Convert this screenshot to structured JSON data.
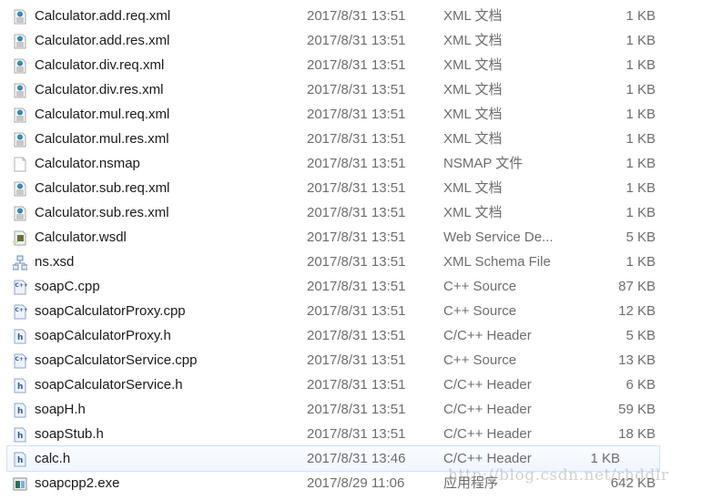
{
  "files": [
    {
      "name": "Calculator.add.req.xml",
      "date": "2017/8/31 13:51",
      "type": "XML 文档",
      "size": "1 KB",
      "icon": "xml-document-icon"
    },
    {
      "name": "Calculator.add.res.xml",
      "date": "2017/8/31 13:51",
      "type": "XML 文档",
      "size": "1 KB",
      "icon": "xml-document-icon"
    },
    {
      "name": "Calculator.div.req.xml",
      "date": "2017/8/31 13:51",
      "type": "XML 文档",
      "size": "1 KB",
      "icon": "xml-document-icon"
    },
    {
      "name": "Calculator.div.res.xml",
      "date": "2017/8/31 13:51",
      "type": "XML 文档",
      "size": "1 KB",
      "icon": "xml-document-icon"
    },
    {
      "name": "Calculator.mul.req.xml",
      "date": "2017/8/31 13:51",
      "type": "XML 文档",
      "size": "1 KB",
      "icon": "xml-document-icon"
    },
    {
      "name": "Calculator.mul.res.xml",
      "date": "2017/8/31 13:51",
      "type": "XML 文档",
      "size": "1 KB",
      "icon": "xml-document-icon"
    },
    {
      "name": "Calculator.nsmap",
      "date": "2017/8/31 13:51",
      "type": "NSMAP 文件",
      "size": "1 KB",
      "icon": "blank-file-icon"
    },
    {
      "name": "Calculator.sub.req.xml",
      "date": "2017/8/31 13:51",
      "type": "XML 文档",
      "size": "1 KB",
      "icon": "xml-document-icon"
    },
    {
      "name": "Calculator.sub.res.xml",
      "date": "2017/8/31 13:51",
      "type": "XML 文档",
      "size": "1 KB",
      "icon": "xml-document-icon"
    },
    {
      "name": "Calculator.wsdl",
      "date": "2017/8/31 13:51",
      "type": "Web Service De...",
      "size": "5 KB",
      "icon": "wsdl-file-icon"
    },
    {
      "name": "ns.xsd",
      "date": "2017/8/31 13:51",
      "type": "XML Schema File",
      "size": "1 KB",
      "icon": "xsd-schema-icon"
    },
    {
      "name": "soapC.cpp",
      "date": "2017/8/31 13:51",
      "type": "C++ Source",
      "size": "87 KB",
      "icon": "cpp-source-icon"
    },
    {
      "name": "soapCalculatorProxy.cpp",
      "date": "2017/8/31 13:51",
      "type": "C++ Source",
      "size": "12 KB",
      "icon": "cpp-source-icon"
    },
    {
      "name": "soapCalculatorProxy.h",
      "date": "2017/8/31 13:51",
      "type": "C/C++ Header",
      "size": "5 KB",
      "icon": "header-file-icon"
    },
    {
      "name": "soapCalculatorService.cpp",
      "date": "2017/8/31 13:51",
      "type": "C++ Source",
      "size": "13 KB",
      "icon": "cpp-source-icon"
    },
    {
      "name": "soapCalculatorService.h",
      "date": "2017/8/31 13:51",
      "type": "C/C++ Header",
      "size": "6 KB",
      "icon": "header-file-icon"
    },
    {
      "name": "soapH.h",
      "date": "2017/8/31 13:51",
      "type": "C/C++ Header",
      "size": "59 KB",
      "icon": "header-file-icon"
    },
    {
      "name": "soapStub.h",
      "date": "2017/8/31 13:51",
      "type": "C/C++ Header",
      "size": "18 KB",
      "icon": "header-file-icon"
    },
    {
      "name": "calc.h",
      "date": "2017/8/31 13:46",
      "type": "C/C++ Header",
      "size": "1 KB",
      "icon": "header-file-icon",
      "hover": true
    },
    {
      "name": "soapcpp2.exe",
      "date": "2017/8/29 11:06",
      "type": "应用程序",
      "size": "642 KB",
      "icon": "executable-icon"
    }
  ],
  "watermark": "http://blog.csdn.net/rhddlr"
}
